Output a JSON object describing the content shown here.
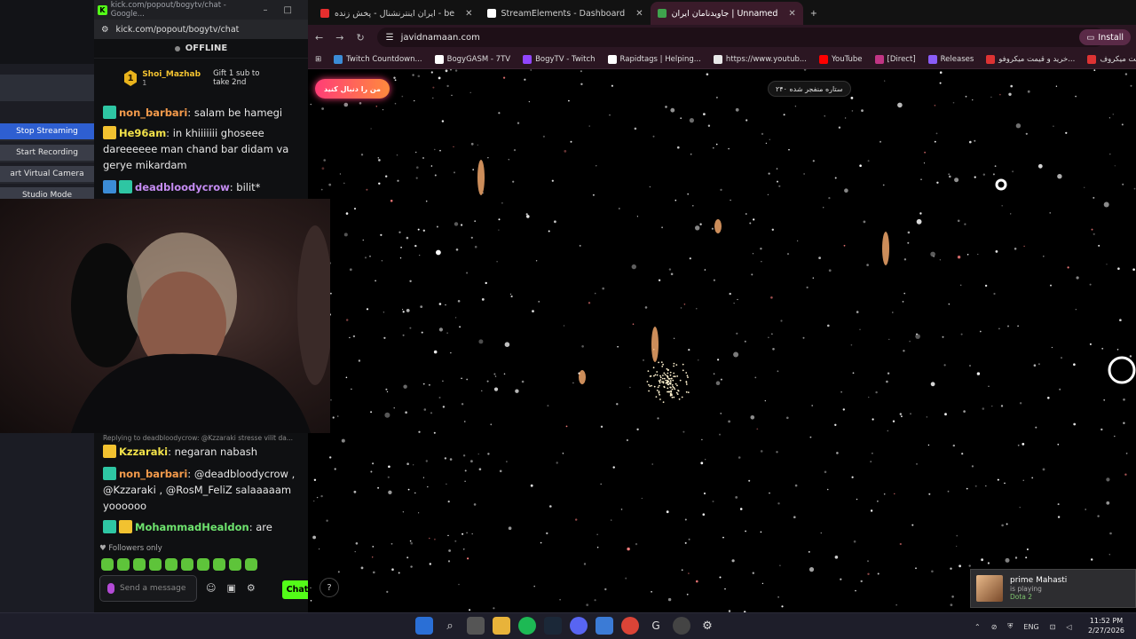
{
  "obs": {
    "buttons": [
      "Stop Streaming",
      "Start Recording",
      "art Virtual Camera",
      "Studio Mode"
    ]
  },
  "kick": {
    "window_title": "kick.com/popout/bogytv/chat - Google...",
    "url": "kick.com/popout/bogytv/chat",
    "status": "OFFLINE",
    "gifter": {
      "name": "Shoi_Mazhab",
      "rank": "1",
      "count": "1",
      "gift_text": "Gift 1 sub to take 2nd"
    },
    "messages": [
      {
        "user": "non_barbari",
        "user_color": "#f39a4b",
        "text": ": salam be hamegi"
      },
      {
        "user": "He96am",
        "user_color": "#f2e24a",
        "text": ": in khiiiiiii ghoseee dareeeeee man chand bar didam va gerye mikardam"
      },
      {
        "user": "deadbloodycrow",
        "user_color": "#c58cf2",
        "text": ": bilit*"
      },
      {
        "reply": "Replying to deadbloodycrow: @Kzzaraki stresse vilit da..."
      },
      {
        "user": "Kzzaraki",
        "user_color": "#f2e24a",
        "text": ": negaran nabash"
      },
      {
        "user": "non_barbari",
        "user_color": "#f39a4b",
        "text": ": @deadbloodycrow , @Kzzaraki , @RosM_FeliZ salaaaaam yoooooo"
      },
      {
        "user": "MohammadHealdon",
        "user_color": "#6ee36e",
        "text": ": are"
      }
    ],
    "followers_only": "Followers only",
    "input_placeholder": "Send a message",
    "chat_button": "Chat"
  },
  "browser": {
    "tabs": [
      {
        "label": "ایران اینترنشنال - پخش زنده - be",
        "color": "#e62e2e"
      },
      {
        "label": "StreamElements - Dashboard",
        "color": "#ffffff"
      },
      {
        "label": "جاویدنامان ایران | Unnamed",
        "color": "#3fa34d",
        "active": true
      }
    ],
    "url": "javidnamaan.com",
    "install": "Install",
    "bookmarks": [
      {
        "label": "Twitch Countdown...",
        "color": "#3b8cd6"
      },
      {
        "label": "BogyGASM - 7TV",
        "color": "#ffffff"
      },
      {
        "label": "BogyTV - Twitch",
        "color": "#9146ff"
      },
      {
        "label": "Rapidtags | Helping...",
        "color": "#ffffff"
      },
      {
        "label": "https://www.youtub...",
        "color": "#e8e8e8"
      },
      {
        "label": "YouTube",
        "color": "#ff0000"
      },
      {
        "label": "[Direct]",
        "color": "#c13584"
      },
      {
        "label": "Releases",
        "color": "#8a5cf6"
      },
      {
        "label": "خرید و قیمت میکروفو...",
        "color": "#d33"
      },
      {
        "label": "خرید و قیمت میکروف...",
        "color": "#d33"
      },
      {
        "label": "...یس می",
        "color": "#3fa34d"
      }
    ]
  },
  "page": {
    "follow_button": "من را دنبال کنید",
    "counter": "۲۴۰ ستاره منفجر شده",
    "help": "?"
  },
  "notification": {
    "name": "prime Mahasti",
    "status": "is playing",
    "game": "Dota 2"
  },
  "taskbar": {
    "lang": "ENG",
    "time": "11:52 PM",
    "date": "2/27/2026"
  }
}
